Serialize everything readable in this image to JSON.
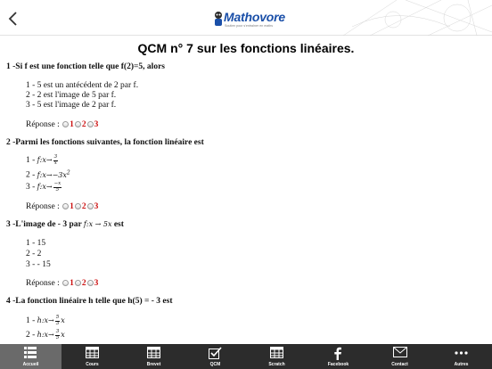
{
  "header": {
    "logo_text": "Mathovore",
    "logo_tagline": "Soutien pour s'entraîner en maths"
  },
  "page": {
    "title": "QCM n° 7 sur les fonctions linéaires."
  },
  "reponse_label": "Réponse :",
  "radio_labels": [
    "1",
    "2",
    "3"
  ],
  "questions": [
    {
      "title": "1 -Si f est une fonction telle que f(2)=5, alors",
      "options": [
        "1 - 5 est un antécédent de 2 par f.",
        "2 - 2 est l'image de 5 par f.",
        "3 - 5 est l'image de 2 par f."
      ]
    },
    {
      "title": "2 -Parmi les fonctions suivantes, la fonction linéaire est",
      "prefixes": [
        "1 -",
        "2 -",
        "3 -"
      ],
      "math": {
        "f": "f",
        "x": "x",
        "arrow": "→",
        "o1_num": "3",
        "o1_den": "x",
        "o2": "−3x",
        "o2_exp": "2",
        "o3_num": "−x",
        "o3_den": "5"
      }
    },
    {
      "title_before": "3 -L'image de - 3 par",
      "title_math": "f:x → 5x",
      "title_after": "est",
      "options": [
        "1 - 15",
        "2 - 2",
        "3 - - 15"
      ]
    },
    {
      "title": "4 -La fonction linéaire h telle que h(5) =  - 3 est",
      "prefixes": [
        "1 -",
        "2 -"
      ],
      "math": {
        "h": "h",
        "x": "x",
        "arrow": "→",
        "o1_num": "5",
        "o1_den": "3",
        "o2_num": "3",
        "o2_den": "5"
      }
    }
  ],
  "tabs": [
    {
      "label": "Accueil",
      "icon": "home-grid-icon"
    },
    {
      "label": "Cours",
      "icon": "table-icon"
    },
    {
      "label": "Brevet",
      "icon": "table-icon"
    },
    {
      "label": "QCM",
      "icon": "checkbox-icon"
    },
    {
      "label": "Scratch",
      "icon": "table-icon"
    },
    {
      "label": "Facebook",
      "icon": "facebook-icon"
    },
    {
      "label": "Contact",
      "icon": "mail-icon"
    },
    {
      "label": "Autres",
      "icon": "more-icon"
    }
  ],
  "colors": {
    "tabbar": "#2c2c2c",
    "tab_active": "#6a6a6a",
    "radio_number": "#cc1111",
    "logo": "#1a4fa8"
  }
}
